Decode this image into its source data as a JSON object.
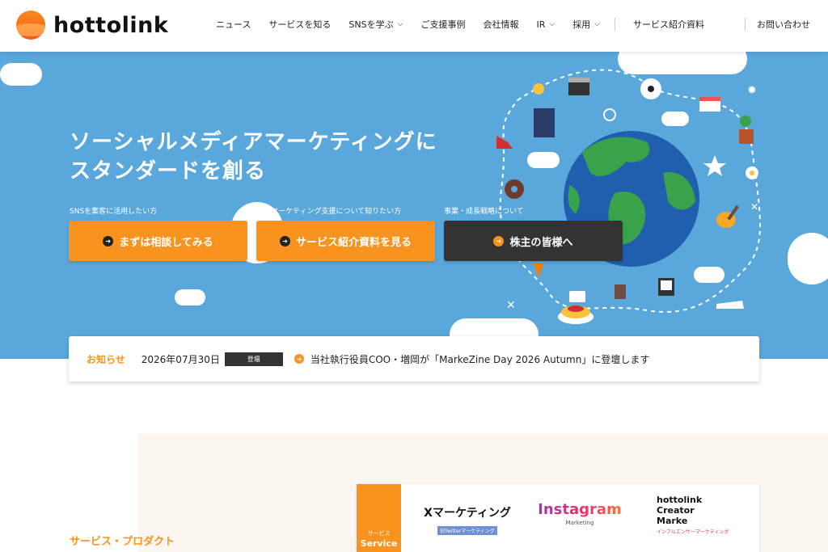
{
  "header": {
    "logo_text": "hottolink",
    "nav": [
      {
        "label": "ニュース",
        "dropdown": false
      },
      {
        "label": "サービスを知る",
        "dropdown": false
      },
      {
        "label": "SNSを学ぶ",
        "dropdown": true
      },
      {
        "label": "ご支援事例",
        "dropdown": false
      },
      {
        "label": "会社情報",
        "dropdown": false
      },
      {
        "label": "IR",
        "dropdown": true
      },
      {
        "label": "採用",
        "dropdown": true
      }
    ],
    "nav_doc": "サービス紹介資料",
    "nav_contact": "お問い合わせ"
  },
  "hero": {
    "title_line1": "ソーシャルメディアマーケティングに",
    "title_line2": "スタンダードを創る",
    "ctas": [
      {
        "caption": "SNSを集客に活用したい方",
        "label": "まずは相談してみる",
        "style": "orange"
      },
      {
        "caption": "SNSマーケティング支援について知りたい方",
        "label": "サービス紹介資料を見る",
        "style": "orange"
      },
      {
        "caption": "事業・成長戦略について",
        "label": "株主の皆様へ",
        "style": "dark"
      }
    ]
  },
  "news": {
    "label": "お知らせ",
    "date": "2026年07月30日",
    "badge": "登壇",
    "text": "当社執行役員COO・増岡が「MarkeZine Day 2026 Autumn」に登壇します"
  },
  "services": {
    "section_title": "サービス・プロダクト",
    "tab_small": "サービス",
    "tab_big": "Service",
    "brands": [
      {
        "main": "Xマーケティング",
        "sub": "旧Twitterマーケティング"
      },
      {
        "main": "Instagram",
        "sub": "Marketing"
      },
      {
        "main_lines": [
          "hottolink",
          "Creator",
          "Marke"
        ],
        "sub": "インフルエンサーマーケティング"
      }
    ]
  },
  "colors": {
    "accent": "#f7931e",
    "hero_bg": "#5aa7dc",
    "dark_button": "#333333"
  }
}
